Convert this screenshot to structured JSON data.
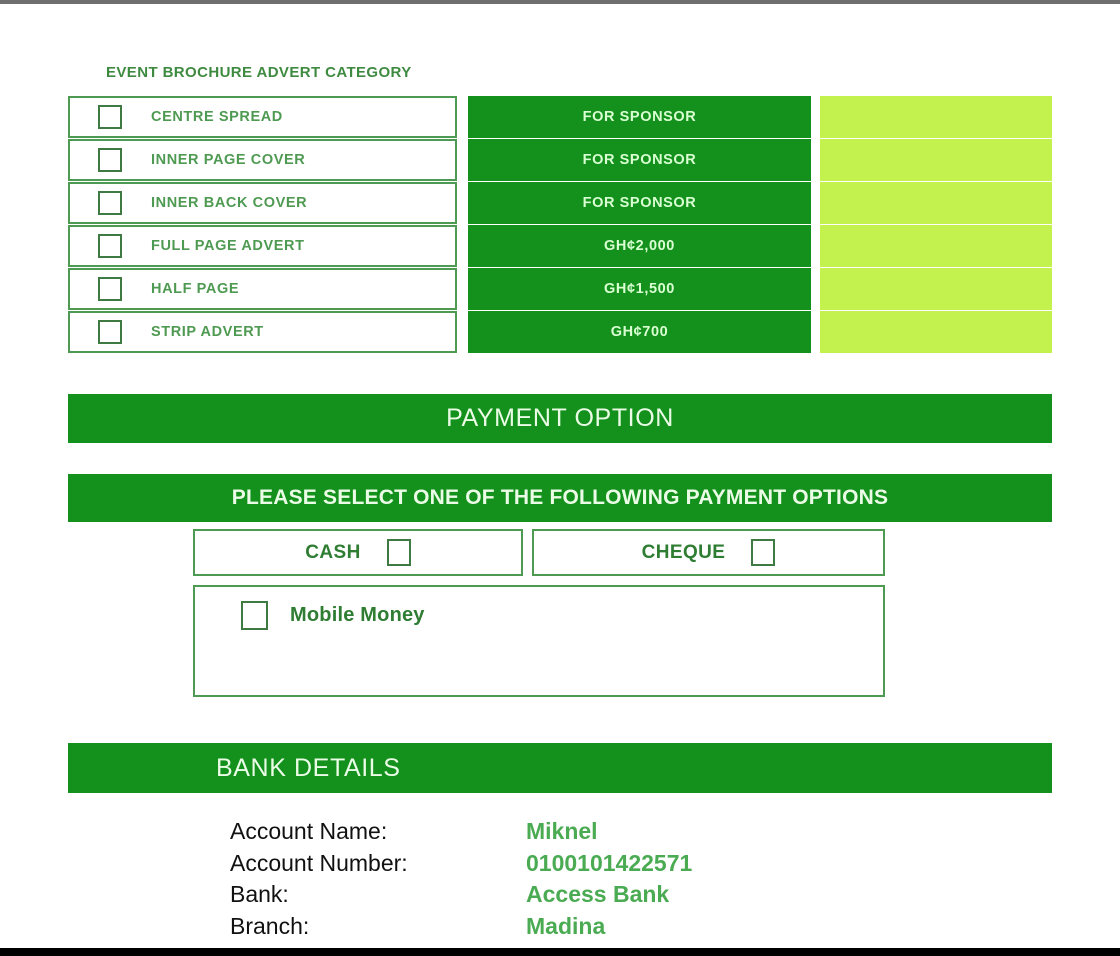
{
  "document": {
    "section_heading": "EVENT BROCHURE ADVERT CATEGORY"
  },
  "advert_category_table": {
    "rows": [
      {
        "checkbox_icon": "checkbox-unchecked-icon",
        "label": "CENTRE SPREAD",
        "price": "FOR SPONSOR",
        "blank": ""
      },
      {
        "checkbox_icon": "checkbox-unchecked-icon",
        "label": "INNER PAGE COVER",
        "price": "FOR SPONSOR",
        "blank": ""
      },
      {
        "checkbox_icon": "checkbox-unchecked-icon",
        "label": "INNER BACK COVER",
        "price": "FOR SPONSOR",
        "blank": ""
      },
      {
        "checkbox_icon": "checkbox-unchecked-icon",
        "label": "FULL PAGE ADVERT",
        "price": "GH¢2,000",
        "blank": ""
      },
      {
        "checkbox_icon": "checkbox-unchecked-icon",
        "label": "HALF PAGE",
        "price": "GH¢1,500",
        "blank": ""
      },
      {
        "checkbox_icon": "checkbox-unchecked-icon",
        "label": "STRIP ADVERT",
        "price": "GH¢700",
        "blank": ""
      }
    ]
  },
  "payment": {
    "banner_title": "PAYMENT OPTION",
    "instruction": "PLEASE SELECT ONE OF THE FOLLOWING PAYMENT OPTIONS",
    "options": {
      "cash": "CASH",
      "cheque": "CHEQUE",
      "mobile_money": "Mobile Money"
    }
  },
  "bank_details": {
    "banner_title": "BANK DETAILS",
    "fields": [
      {
        "label": "Account Name:",
        "value": "Miknel"
      },
      {
        "label": "Account Number:",
        "value": "0100101422571"
      },
      {
        "label": "Bank:",
        "value": "Access Bank"
      },
      {
        "label": "Branch:",
        "value": "Madina"
      }
    ]
  },
  "colors": {
    "dark_green": "#14901c",
    "mid_green": "#4f9a52",
    "light_green": "#c3f24e",
    "value_green": "#4aab52",
    "banner_text": "#eafce6"
  }
}
